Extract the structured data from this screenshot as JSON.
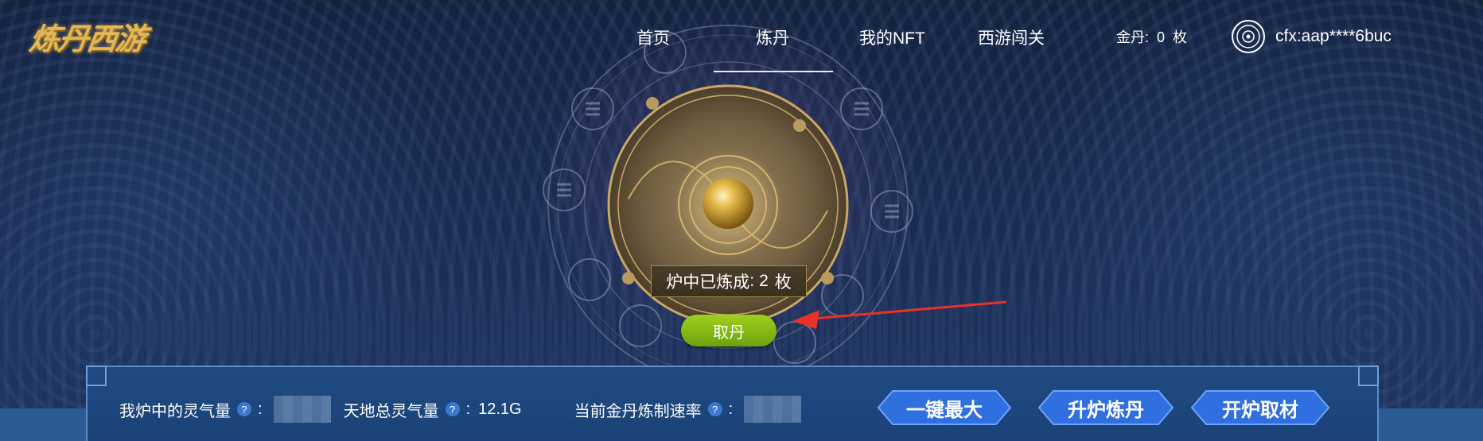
{
  "header": {
    "logo_text": "炼丹西游",
    "nav": [
      {
        "label": "首页"
      },
      {
        "label": "炼丹"
      },
      {
        "label": "我的NFT"
      },
      {
        "label": "西游闯关"
      }
    ],
    "active_tab": "炼丹",
    "gold": {
      "label": "金丹:",
      "value": "0",
      "unit": "枚"
    },
    "wallet_address": "cfx:aap****6buc"
  },
  "furnace": {
    "status_label": "炉中已炼成",
    "status_value": "2",
    "status_unit": "枚",
    "collect_label": "取丹"
  },
  "panel": {
    "my_energy_label": "我炉中的灵气量",
    "total_energy_label": "天地总灵气量",
    "total_energy_value": "12.1G",
    "rate_label": "当前金丹炼制速率",
    "help_glyph": "?",
    "colon": ":",
    "buttons": [
      "一键最大",
      "升炉炼丹",
      "开炉取材"
    ]
  },
  "colors": {
    "gold": "#e2b756",
    "collect_button": "#8cc21a",
    "hex_button": "#2f6fe0",
    "panel": "#1f4b82"
  }
}
